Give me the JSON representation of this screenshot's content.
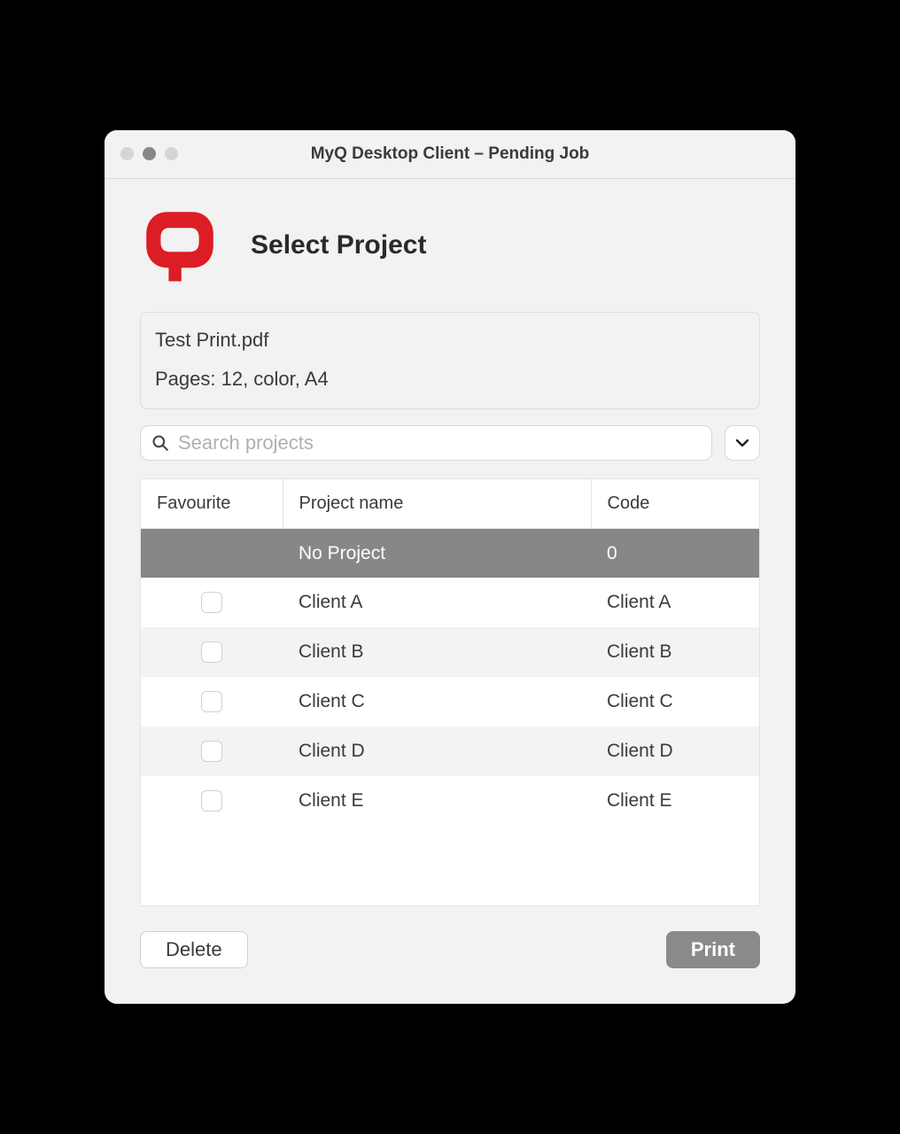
{
  "window": {
    "title": "MyQ Desktop Client – Pending Job"
  },
  "header": {
    "title": "Select Project"
  },
  "job": {
    "filename": "Test Print.pdf",
    "details": "Pages: 12, color, A4"
  },
  "search": {
    "placeholder": "Search projects"
  },
  "table": {
    "columns": {
      "favourite": "Favourite",
      "name": "Project name",
      "code": "Code"
    },
    "rows": [
      {
        "favourite": null,
        "name": "No Project",
        "code": "0",
        "selected": true
      },
      {
        "favourite": false,
        "name": "Client A",
        "code": "Client A",
        "selected": false
      },
      {
        "favourite": false,
        "name": "Client B",
        "code": "Client B",
        "selected": false
      },
      {
        "favourite": false,
        "name": "Client C",
        "code": "Client C",
        "selected": false
      },
      {
        "favourite": false,
        "name": "Client D",
        "code": "Client D",
        "selected": false
      },
      {
        "favourite": false,
        "name": "Client E",
        "code": "Client E",
        "selected": false
      }
    ]
  },
  "actions": {
    "delete": "Delete",
    "print": "Print"
  }
}
